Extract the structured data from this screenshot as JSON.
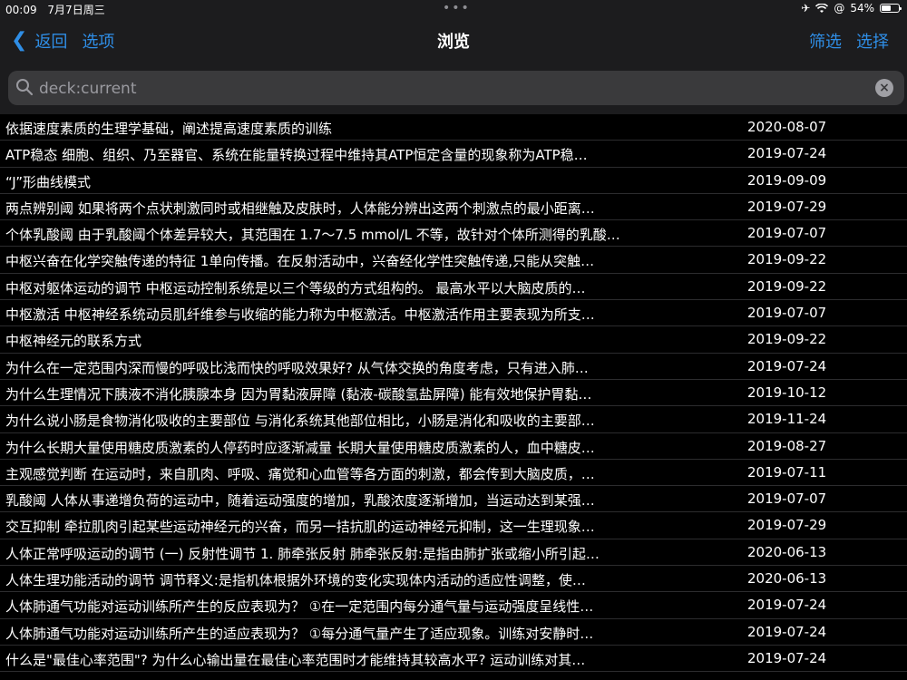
{
  "status": {
    "time": "00:09",
    "date": "7月7日周三",
    "battery": "54%",
    "battery_level": 0.54
  },
  "nav": {
    "back_label": "返回",
    "options_label": "选项",
    "title": "浏览",
    "filter_label": "筛选",
    "select_label": "选择"
  },
  "search": {
    "value": "deck:current"
  },
  "rows": [
    {
      "text": "依据速度素质的生理学基础，阐述提高速度素质的训练",
      "date": "2020-08-07"
    },
    {
      "text": "ATP稳态 细胞、组织、乃至器官、系统在能量转换过程中维持其ATP恒定含量的现象称为ATP稳…",
      "date": "2019-07-24"
    },
    {
      "text": "“J”形曲线模式",
      "date": "2019-09-09"
    },
    {
      "text": "两点辨别阈 如果将两个点状刺激同时或相继触及皮肤时，人体能分辨出这两个刺激点的最小距离…",
      "date": "2019-07-29"
    },
    {
      "text": "个体乳酸阈 由于乳酸阈个体差异较大，其范围在 1.7～7.5 mmol/L 不等，故针对个体所测得的乳酸…",
      "date": "2019-07-07"
    },
    {
      "text": "中枢兴奋在化学突触传递的特征 1单向传播。在反射活动中，兴奋经化学性突触传递,只能从突触…",
      "date": "2019-09-22"
    },
    {
      "text": "中枢对躯体运动的调节 中枢运动控制系统是以三个等级的方式组构的。 最高水平以大脑皮质的…",
      "date": "2019-09-22"
    },
    {
      "text": "中枢激活 中枢神经系统动员肌纤维参与收缩的能力称为中枢激活。中枢激活作用主要表现为所支…",
      "date": "2019-07-07"
    },
    {
      "text": "中枢神经元的联系方式",
      "date": "2019-09-22"
    },
    {
      "text": "为什么在一定范围内深而慢的呼吸比浅而快的呼吸效果好? 从气体交换的角度考虑，只有进入肺…",
      "date": "2019-07-24"
    },
    {
      "text": "为什么生理情况下胰液不消化胰腺本身 因为胃黏液屏障 (黏液-碳酸氢盐屏障) 能有效地保护胃黏…",
      "date": "2019-10-12"
    },
    {
      "text": "为什么说小肠是食物消化吸收的主要部位 与消化系统其他部位相比，小肠是消化和吸收的主要部…",
      "date": "2019-11-24"
    },
    {
      "text": "为什么长期大量使用糖皮质激素的人停药时应逐渐减量 长期大量使用糖皮质激素的人，血中糖皮…",
      "date": "2019-08-27"
    },
    {
      "text": "主观感觉判断 在运动时，来自肌肉、呼吸、痛觉和心血管等各方面的刺激，都会传到大脑皮质，…",
      "date": "2019-07-11"
    },
    {
      "text": "乳酸阈 人体从事递增负荷的运动中，随着运动强度的增加，乳酸浓度逐渐增加，当运动达到某强…",
      "date": "2019-07-07"
    },
    {
      "text": "交互抑制 牵拉肌肉引起某些运动神经元的兴奋，而另一拮抗肌的运动神经元抑制，这一生理现象…",
      "date": "2019-07-29"
    },
    {
      "text": "人体正常呼吸运动的调节 (一) 反射性调节 1. 肺牵张反射 肺牵张反射:是指由肺扩张或缩小所引起…",
      "date": "2020-06-13"
    },
    {
      "text": "人体生理功能活动的调节 调节释义:是指机体根据外环境的变化实现体内活动的适应性调整，使…",
      "date": "2020-06-13"
    },
    {
      "text": "人体肺通气功能对运动训练所产生的反应表现为？ ①在一定范围内每分通气量与运动强度呈线性…",
      "date": "2019-07-24"
    },
    {
      "text": "人体肺通气功能对运动训练所产生的适应表现为？ ①每分通气量产生了适应现象。训练对安静时…",
      "date": "2019-07-24"
    },
    {
      "text": "什么是\"最佳心率范围\"? 为什么心输出量在最佳心率范围时才能维持其较高水平? 运动训练对其…",
      "date": "2019-07-24"
    }
  ]
}
